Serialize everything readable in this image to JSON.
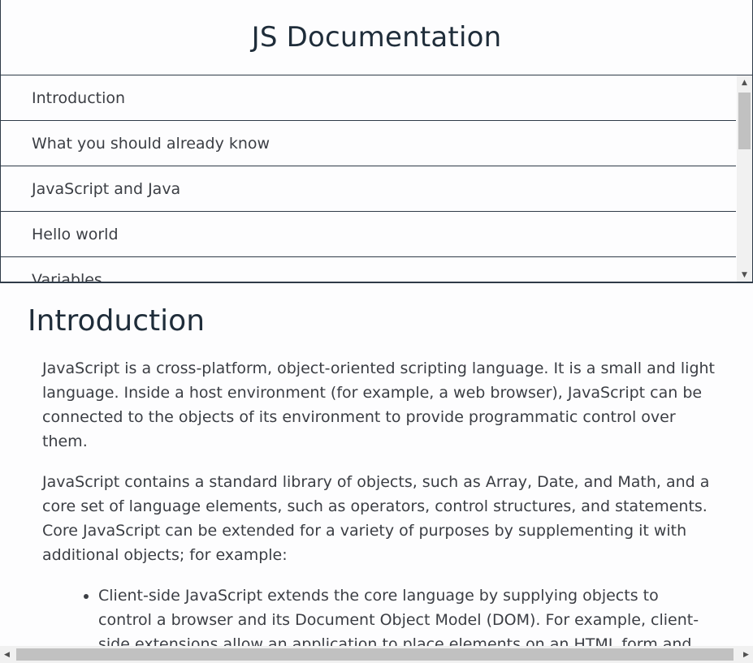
{
  "header": {
    "title": "JS Documentation"
  },
  "nav": {
    "items": [
      {
        "label": "Introduction"
      },
      {
        "label": "What you should already know"
      },
      {
        "label": "JavaScript and Java"
      },
      {
        "label": "Hello world"
      },
      {
        "label": "Variables"
      }
    ]
  },
  "main": {
    "section_title": "Introduction",
    "paragraphs": [
      "JavaScript is a cross-platform, object-oriented scripting language. It is a small and light language. Inside a host environment (for example, a web browser), JavaScript can be connected to the objects of its environment to provide programmatic control over them.",
      "JavaScript contains a standard library of objects, such as Array, Date, and Math, and a core set of language elements, such as operators, control structures, and statements. Core JavaScript can be extended for a variety of purposes by supplementing it with additional objects; for example:"
    ],
    "list": [
      "Client-side JavaScript extends the core language by supplying objects to control a browser and its Document Object Model (DOM). For example, client-side extensions allow an application to place elements on an HTML form and respond to user events such as mouse clicks, form input, and page navigation."
    ]
  },
  "icons": {
    "scroll_up": "triangle-up-icon",
    "scroll_down": "triangle-down-icon",
    "scroll_left": "triangle-left-icon",
    "scroll_right": "triangle-right-icon"
  }
}
